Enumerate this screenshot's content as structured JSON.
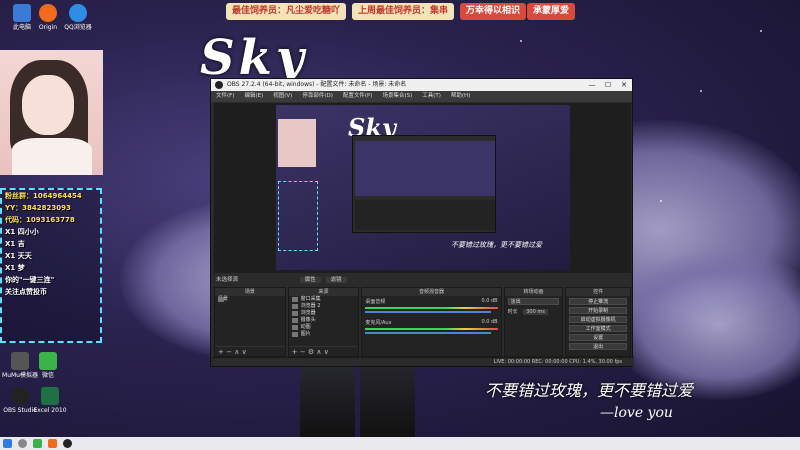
{
  "banners": [
    {
      "text": "最佳饲养员：凡尘爱吃糖吖",
      "bg": "#f3e3b8",
      "fg": "#c0392b"
    },
    {
      "text": "上周最佳饲养员：集串",
      "bg": "#f3e3b8",
      "fg": "#c0392b"
    },
    {
      "text": "万幸得以相识",
      "bg": "#d94a3c",
      "fg": "#ffffff"
    },
    {
      "text": "承蒙厚爱",
      "bg": "#d94a3c",
      "fg": "#ffffff"
    }
  ],
  "desktop_icons": [
    {
      "label": "此电脑",
      "color": "#3a7bd5"
    },
    {
      "label": "Origin",
      "color": "#f26a1b"
    },
    {
      "label": "QQ浏览器",
      "color": "#2f8de4"
    },
    {
      "label": "MuMu模拟器",
      "color": "#555555"
    },
    {
      "label": "微信",
      "color": "#3bb34a"
    },
    {
      "label": "OBS Studio",
      "color": "#222222"
    },
    {
      "label": "Excel 2010",
      "color": "#1e7145"
    }
  ],
  "overlay": {
    "title": "Sky",
    "bottom_line": "不要错过玫瑰，更不要错过爱",
    "signature": "—love you"
  },
  "chat_lines": [
    {
      "text": "粉丝群：1064964454",
      "cls": ""
    },
    {
      "text": "YY：3842823093",
      "cls": ""
    },
    {
      "text": "代码：1093163778",
      "cls": ""
    },
    {
      "text": "X1   四小小",
      "cls": "w"
    },
    {
      "text": "X1   吉",
      "cls": "w"
    },
    {
      "text": "X1   天天",
      "cls": "w"
    },
    {
      "text": "X1   梦",
      "cls": "w"
    },
    {
      "text": "你的\"一键三连\"",
      "cls": "w"
    },
    {
      "text": "关注点赞投币",
      "cls": "w"
    }
  ],
  "obs": {
    "title": "OBS 27.2.4 (64-bit, windows) - 配置文件: 未命名 - 场景: 未命名",
    "menus": [
      "文件(F)",
      "编辑(E)",
      "视图(V)",
      "停靠部件(D)",
      "配置文件(P)",
      "场景集合(S)",
      "工具(T)",
      "帮助(H)"
    ],
    "status_label": "未选择源",
    "status_btns": [
      "属性",
      "滤镜"
    ],
    "docks": {
      "scenes": {
        "title": "场景",
        "items": [
          "场景"
        ]
      },
      "sources": {
        "title": "来源",
        "items": [
          "窗口采集",
          "浏览器 2",
          "浏览器",
          "摄像头",
          "动图",
          "图片"
        ]
      },
      "mixer": {
        "title": "音频混音器",
        "channels": [
          {
            "name": "桌面音频",
            "db": "0.0 dB"
          },
          {
            "name": "麦克风/Aux",
            "db": "0.0 dB"
          }
        ]
      },
      "transitions": {
        "title": "转场动画",
        "mode": "淡出",
        "duration_label": "时长",
        "duration": "300 ms"
      },
      "controls": {
        "title": "控件",
        "buttons": [
          "停止推流",
          "开始录制",
          "启动虚拟摄像机",
          "工作室模式",
          "设置",
          "退出"
        ]
      }
    },
    "status": "LIVE: 00:00:00   REC: 00:00:00   CPU: 1.4%, 30.00 fps"
  }
}
